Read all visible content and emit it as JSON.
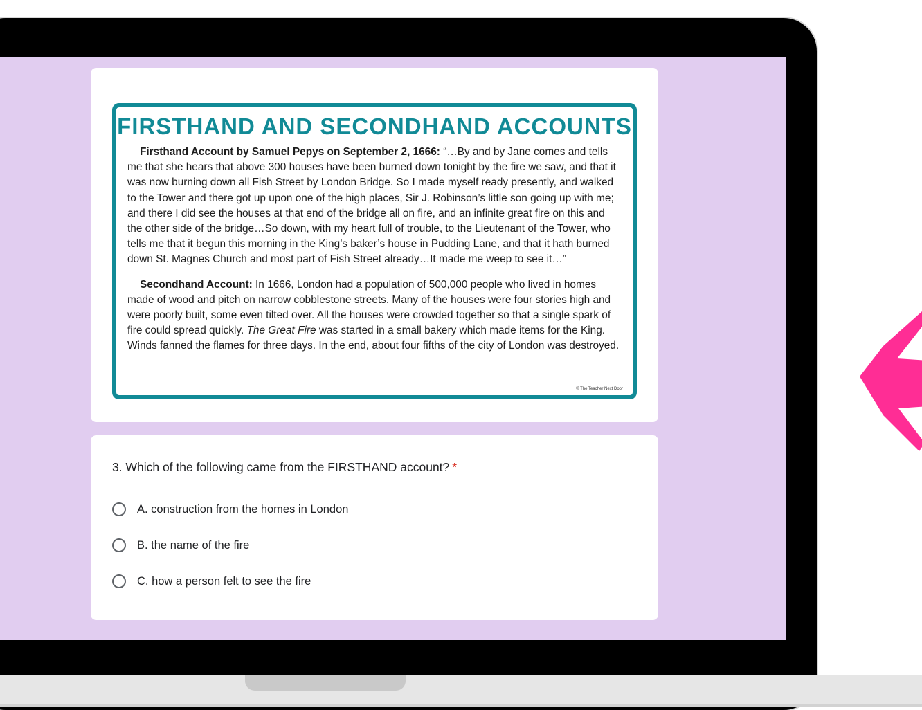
{
  "worksheet": {
    "title": "Firsthand and Secondhand Accounts",
    "firsthand_label": "Firsthand Account by Samuel Pepys on September 2, 1666:",
    "firsthand_text": " “…By and by Jane comes and tells me that she hears that above 300 houses have been burned down tonight by the fire we saw, and that it was now burning down all Fish Street by London Bridge. So I made myself ready presently, and walked to the Tower and there got up upon one of the high places, Sir J. Robinson’s little son going up with me; and there I did see the houses at that end of the bridge all on fire, and an infinite great fire on this and the other side of the bridge…So down, with my heart full of trouble, to the Lieutenant of the Tower, who tells me that it begun this morning in the King’s baker’s house in Pudding Lane, and that it hath burned down St. Magnes Church and most part of Fish Street already…It made me weep to see it…”",
    "secondhand_label": "Secondhand Account:",
    "secondhand_text_1": " In 1666, London had a population of 500,000 people who lived in homes made of wood and pitch on narrow cobblestone streets. Many of the houses were four stories high and were poorly built, some even tilted over. All the houses were crowded together so that a single spark of fire could spread quickly. ",
    "secondhand_italic": "The Great Fire",
    "secondhand_text_2": " was started in a small bakery which made items for the King. Winds fanned the flames for three days. In the end, about four fifths of the city of London was destroyed.",
    "credit": "© The Teacher Next Door"
  },
  "question": {
    "text": "3. Which of the following came from the FIRSTHAND account?",
    "required_mark": "*",
    "options": [
      {
        "label": "A. construction from the homes in London"
      },
      {
        "label": "B. the name of the fire"
      },
      {
        "label": "C. how a person felt to see the fire"
      }
    ]
  },
  "colors": {
    "screen_bg": "#e1cdf0",
    "accent_teal": "#118a96",
    "arrow_pink": "#ff2d95",
    "required_red": "#d93025"
  }
}
